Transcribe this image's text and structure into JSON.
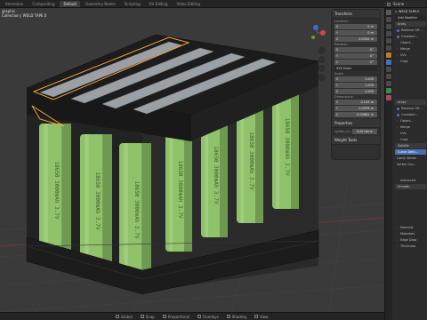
{
  "topbar": {
    "tabs": [
      {
        "label": "Animation"
      },
      {
        "label": "Compositing"
      },
      {
        "label": "Default"
      },
      {
        "label": "Geometry Nodes"
      },
      {
        "label": "Scripting"
      },
      {
        "label": "UV Editing"
      },
      {
        "label": "Video Editing"
      }
    ],
    "active_tab": "Default",
    "scene_label": "Scene"
  },
  "viewport": {
    "info_line1": "graphic",
    "info_line2": "Collection | WELD TAPE.0"
  },
  "npanel": {
    "transform_title": "Transform",
    "location_label": "Location:",
    "location": [
      {
        "axis": "X",
        "value": "0 m"
      },
      {
        "axis": "Y",
        "value": "0 m"
      },
      {
        "axis": "Z",
        "value": "0.0342 m"
      }
    ],
    "rotation_label": "Rotation:",
    "rotation": [
      {
        "axis": "X",
        "value": "0°"
      },
      {
        "axis": "Y",
        "value": "0°"
      },
      {
        "axis": "Z",
        "value": "0°"
      }
    ],
    "rotation_mode": "XYZ Euler",
    "scale_label": "Scale:",
    "scale": [
      {
        "axis": "X",
        "value": "1.000"
      },
      {
        "axis": "Y",
        "value": "1.000"
      },
      {
        "axis": "Z",
        "value": "1.000"
      }
    ],
    "dimensions_label": "Dimensions:",
    "dimensions": [
      {
        "axis": "X",
        "value": "0.143 m"
      },
      {
        "axis": "Y",
        "value": "0.0976 m"
      },
      {
        "axis": "Z",
        "value": "0.00661 m"
      }
    ],
    "properties_title": "Properties",
    "prop_name": "cycles_cu...",
    "edit_value_label": "Edit Value",
    "weight_tools_title": "Weight Tools"
  },
  "properties": {
    "object_name": "WELD TAPE.0",
    "add_modifier_label": "Add Modifier",
    "array_label": "Array",
    "relative_offset_label": "Relative Off...",
    "constant_label": "Constant...",
    "object_offset_label": "Object...",
    "merge_label": "Merge",
    "uvs_label": "UVs",
    "caps_label": "Caps",
    "solidify_label": "Solidify",
    "curve_deform_label": "Curve Defo...",
    "lamp_vertex_label": "Lamp Vertex",
    "vertex_group_label": "Vertex Gro...",
    "advanced_label": "Advanced",
    "smooth_label": "Smooth",
    "normals_label": "Normals",
    "materials_label": "Materials",
    "edge_data_label": "Edge Data",
    "thickness_label": "Thickness"
  },
  "statusbar": {
    "items": [
      {
        "label": "Global"
      },
      {
        "label": "Snap"
      },
      {
        "label": "Proportional"
      },
      {
        "label": "Overlays"
      },
      {
        "label": "Shading"
      },
      {
        "label": "View"
      }
    ]
  },
  "colors": {
    "viewport_bg": "#3a3a3a",
    "cell_green": "#8fc26a",
    "holder_black": "#1c1c1c",
    "weld_tape": "#9aa0a4",
    "selection_orange": "#f2a23a",
    "accent_blue": "#4772b3"
  },
  "cell_label": "18650 3000mAh 3.7V"
}
